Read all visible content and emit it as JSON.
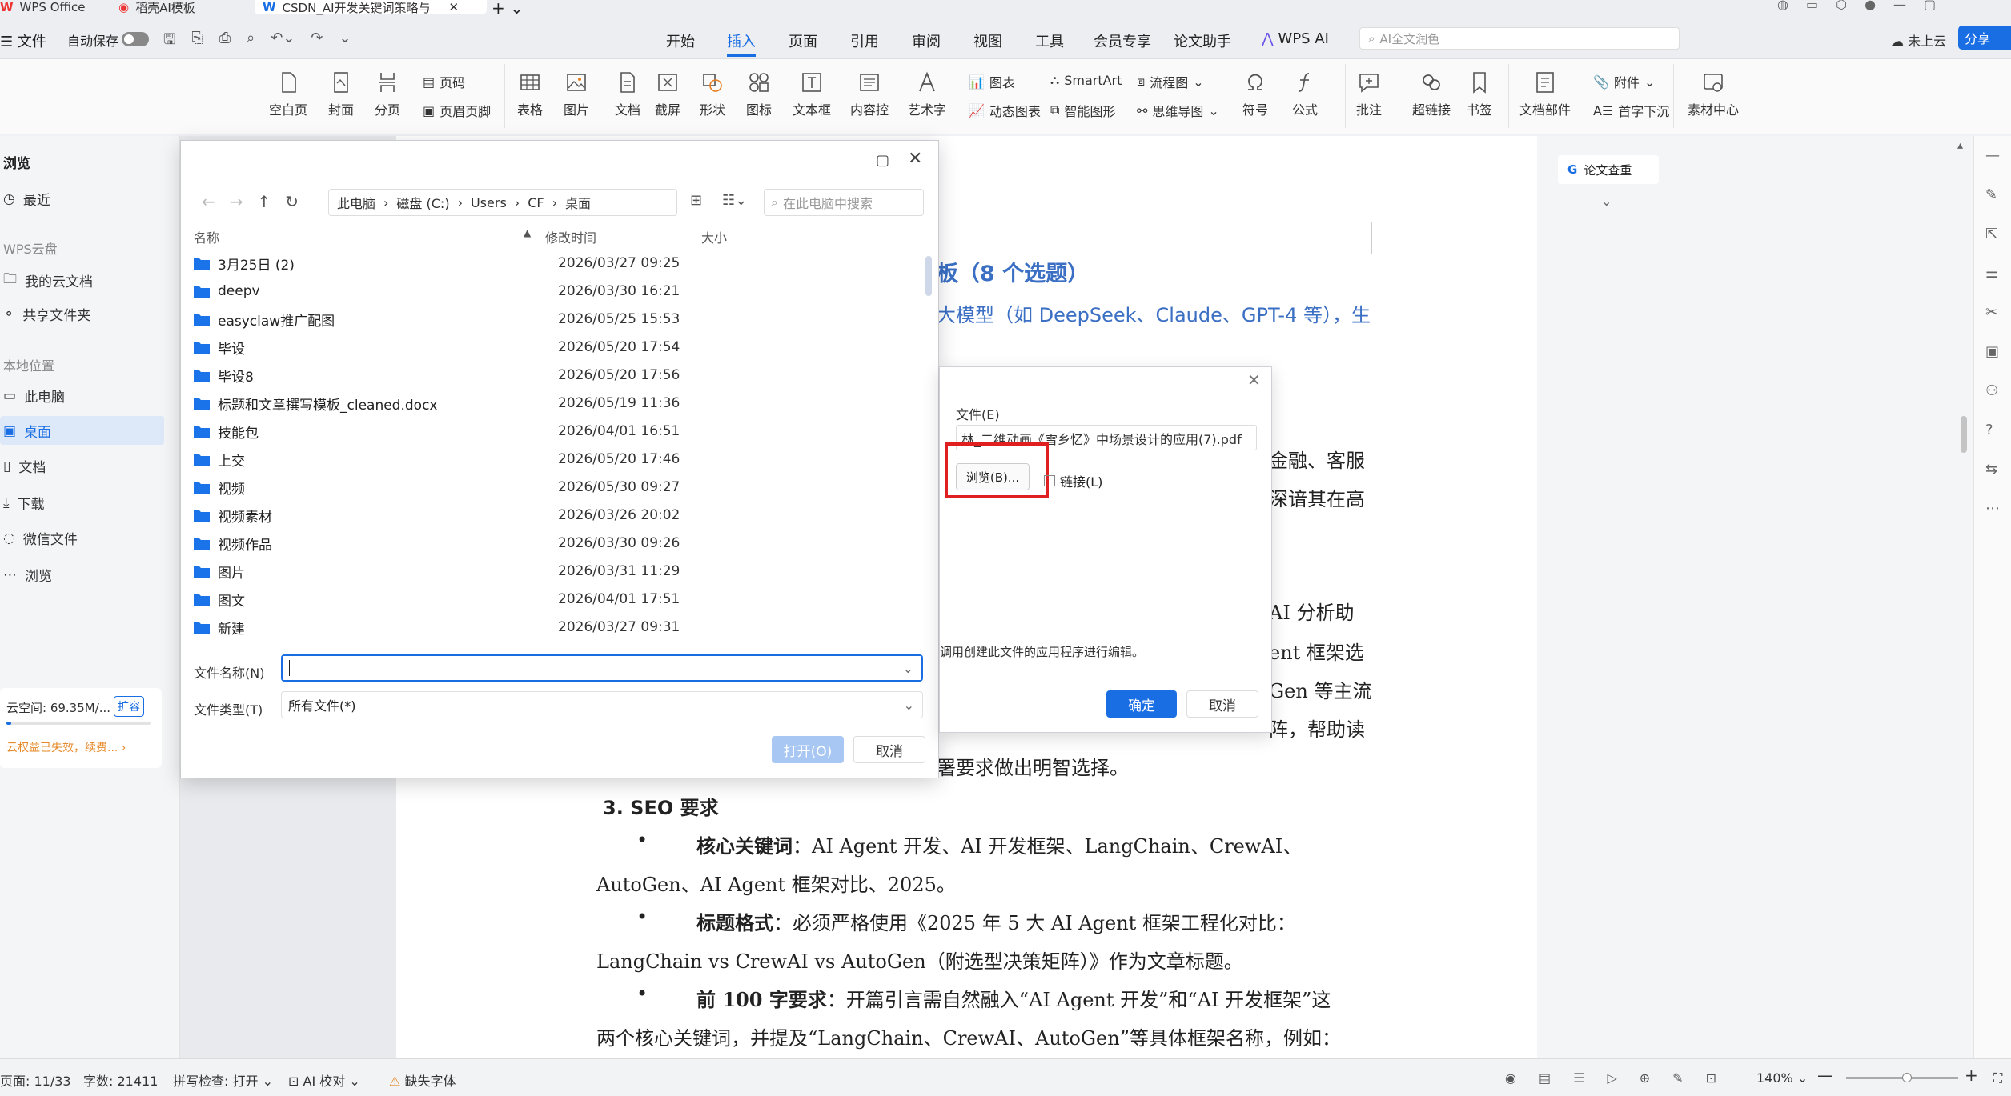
{
  "tabs": [
    {
      "label": "WPS Office"
    },
    {
      "label": "稻壳AI模板"
    },
    {
      "label": "CSDN_AI开发关键词策略与"
    }
  ],
  "menubar": {
    "file": "文件",
    "autosave": "自动保存",
    "items": [
      "开始",
      "插入",
      "页面",
      "引用",
      "审阅",
      "视图",
      "工具",
      "会员专享",
      "论文助手"
    ],
    "active": "插入",
    "wps_ai": "WPS AI",
    "search_placeholder": "AI全文润色",
    "cloud": "未上云",
    "share": "分享"
  },
  "ribbon": {
    "blank_page": "空白页",
    "cover": "封面",
    "page_break": "分页",
    "page_number": "页码",
    "header_footer": "页眉页脚",
    "table": "表格",
    "picture": "图片",
    "document": "文档",
    "screenshot": "截屏",
    "shape": "形状",
    "icon": "图标",
    "textbox": "文本框",
    "content_control": "内容控",
    "wordart": "艺术字",
    "chart": "图表",
    "dynamic_chart": "动态图表",
    "smartart": "SmartArt",
    "smart_shape": "智能图形",
    "flowchart": "流程图",
    "mindmap": "思维导图",
    "symbol": "符号",
    "formula": "公式",
    "comment": "批注",
    "hyperlink": "超链接",
    "bookmark": "书签",
    "doc_parts": "文档部件",
    "attachment": "附件",
    "dropcap": "首字下沉",
    "material": "素材中心"
  },
  "left_panel": {
    "title": "浏览",
    "recent": "最近",
    "cloud_group": "WPS云盘",
    "my_cloud": "我的云文档",
    "shared": "共享文件夹",
    "local_group": "本地位置",
    "this_pc": "此电脑",
    "desktop": "桌面",
    "documents": "文档",
    "downloads": "下载",
    "wechat": "微信文件",
    "browse": "浏览",
    "cloud_space": "云空间: 69.35M/...",
    "expand": "扩容",
    "expired": "云权益已失效，续费..."
  },
  "file_dialog": {
    "breadcrumb": [
      "此电脑",
      "磁盘 (C:)",
      "Users",
      "CF",
      "桌面"
    ],
    "search_placeholder": "在此电脑中搜索",
    "col_name": "名称",
    "col_modified": "修改时间",
    "col_size": "大小",
    "files": [
      {
        "name": "3月25日 (2)",
        "modified": "2026/03/27 09:25"
      },
      {
        "name": "deepv",
        "modified": "2026/03/30 16:21"
      },
      {
        "name": "easyclaw推广配图",
        "modified": "2026/05/25 15:53"
      },
      {
        "name": "毕设",
        "modified": "2026/05/20 17:54"
      },
      {
        "name": "毕设8",
        "modified": "2026/05/20 17:56"
      },
      {
        "name": "标题和文章撰写模板_cleaned.docx",
        "modified": "2026/05/19 11:36"
      },
      {
        "name": "技能包",
        "modified": "2026/04/01 16:51"
      },
      {
        "name": "上交",
        "modified": "2026/05/20 17:46"
      },
      {
        "name": "视频",
        "modified": "2026/05/30 09:27"
      },
      {
        "name": "视频素材",
        "modified": "2026/03/26 20:02"
      },
      {
        "name": "视频作品",
        "modified": "2026/03/30 09:26"
      },
      {
        "name": "图片",
        "modified": "2026/03/31 11:29"
      },
      {
        "name": "图文",
        "modified": "2026/04/01 17:51"
      },
      {
        "name": "新建",
        "modified": "2026/03/27 09:31"
      }
    ],
    "filename_label": "文件名称(N)",
    "filename_value": "",
    "filetype_label": "文件类型(T)",
    "filetype_value": "所有文件(*)",
    "open": "打开(O)",
    "cancel": "取消"
  },
  "object_dialog": {
    "file_label": "文件(E)",
    "file_value": "林_二维动画《雪乡忆》中场景设计的应用(7).pdf",
    "browse": "浏览(B)...",
    "link": "链接(L)",
    "note": "调用创建此文件的应用程序进行编辑。",
    "ok": "确定",
    "cancel": "取消"
  },
  "document": {
    "heading_part": "板（8 个选题）",
    "blue_line": "大模型（如 DeepSeek、Claude、GPT-4 等），生",
    "frag1": "金融、客服",
    "frag2": "深谙其在高",
    "frag3": "AI 分析助",
    "frag4": "ent 框架选",
    "frag5": "Gen 等主流",
    "frag6": "阵，帮助读",
    "frag7": "署要求做出明智选择。",
    "seo_heading": "3. SEO 要求",
    "b1_label": "核心关键词",
    "b1_text": "：AI Agent 开发、AI 开发框架、LangChain、CrewAI、",
    "b1_text2": "AutoGen、AI Agent 框架对比、2025。",
    "b2_label": "标题格式",
    "b2_text": "：必须严格使用《2025 年 5 大 AI Agent 框架工程化对比：",
    "b2_text2": "LangChain vs CrewAI vs AutoGen（附选型决策矩阵）》作为文章标题。",
    "b3_label": "前 100 字要求",
    "b3_text": "：开篇引言需自然融入“AI Agent 开发”和“AI 开发框架”这",
    "b3_text2": "两个核心关键词，并提及“LangChain、CrewAI、AutoGen”等具体框架名称，例如："
  },
  "right_panel": {
    "paper_check": "论文查重"
  },
  "status": {
    "page": "页面: 11/33",
    "words": "字数: 21411",
    "spell": "拼写检查: 打开",
    "ai_check": "AI 校对",
    "missing_font": "缺失字体",
    "zoom": "140%"
  },
  "colors": {
    "accent": "#1a6ee3",
    "highlight_red": "#e02020",
    "doc_blue": "#3a6fc4"
  }
}
